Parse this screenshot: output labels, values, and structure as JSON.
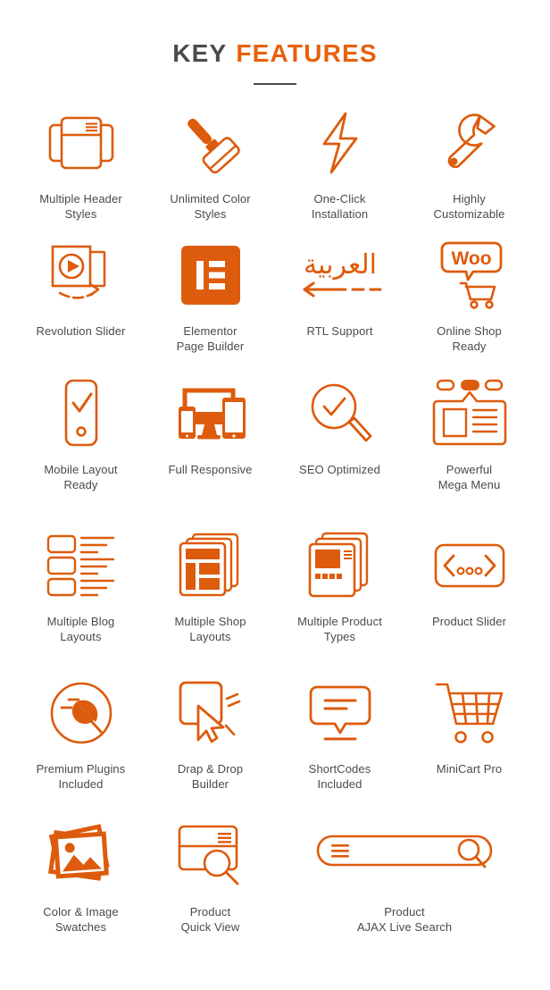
{
  "header": {
    "title_part1": "KEY",
    "title_part2": "FEATURES",
    "accent_color": "#e8600b",
    "text_color": "#4a4a4f"
  },
  "theme": {
    "orange": "#dd5b0c",
    "orange_bright": "#e8600b",
    "label_color": "#4a4a4f",
    "background": "#ffffff"
  },
  "features": [
    {
      "id": "multiple-header-styles",
      "label": "Multiple Header\nStyles",
      "icon": "header-layout-icon"
    },
    {
      "id": "unlimited-color-styles",
      "label": "Unlimited Color\nStyles",
      "icon": "paint-roller-icon"
    },
    {
      "id": "one-click-installation",
      "label": "One-Click\nInstallation",
      "icon": "lightning-bolt-icon"
    },
    {
      "id": "highly-customizable",
      "label": "Highly\nCustomizable",
      "icon": "wrench-icon"
    },
    {
      "id": "revolution-slider",
      "label": "Revolution Slider",
      "icon": "slider-play-icon"
    },
    {
      "id": "elementor-page-builder",
      "label": "Elementor\nPage Builder",
      "icon": "elementor-logo-icon"
    },
    {
      "id": "rtl-support",
      "label": "RTL Support",
      "icon": "arabic-rtl-arrow-icon",
      "icon_text": "العربية"
    },
    {
      "id": "online-shop-ready",
      "label": "Online Shop\nReady",
      "icon": "woocommerce-cart-icon",
      "icon_text": "Woo"
    },
    {
      "id": "mobile-layout-ready",
      "label": "Mobile Layout\nReady",
      "icon": "mobile-check-icon"
    },
    {
      "id": "full-responsive",
      "label": "Full Responsive",
      "icon": "responsive-devices-icon"
    },
    {
      "id": "seo-optimized",
      "label": "SEO Optimized",
      "icon": "magnifier-check-icon"
    },
    {
      "id": "powerful-mega-menu",
      "label": "Powerful\nMega Menu",
      "icon": "mega-menu-icon"
    },
    {
      "id": "multiple-blog-layouts",
      "label": "Multiple Blog\nLayouts",
      "icon": "blog-list-icon"
    },
    {
      "id": "multiple-shop-layouts",
      "label": "Multiple Shop\nLayouts",
      "icon": "shop-pages-icon"
    },
    {
      "id": "multiple-product-types",
      "label": "Multiple Product\nTypes",
      "icon": "product-cards-icon"
    },
    {
      "id": "product-slider",
      "label": "Product Slider",
      "icon": "carousel-arrows-icon"
    },
    {
      "id": "premium-plugins-included",
      "label": "Premium Plugins\nIncluded",
      "icon": "plug-circle-icon"
    },
    {
      "id": "drap-drop-builder",
      "label": "Drap & Drop\nBuilder",
      "icon": "drag-drop-cursor-icon"
    },
    {
      "id": "shortcodes-included",
      "label": "ShortCodes\nIncluded",
      "icon": "speech-bubble-lines-icon"
    },
    {
      "id": "minicart-pro",
      "label": "MiniCart Pro",
      "icon": "shopping-cart-icon"
    },
    {
      "id": "color-image-swatches",
      "label": "Color & Image\nSwatches",
      "icon": "photo-stack-icon"
    },
    {
      "id": "product-quick-view",
      "label": "Product\nQuick View",
      "icon": "quick-view-card-icon"
    },
    {
      "id": "product-ajax-live-search",
      "label": "Product\nAJAX Live Search",
      "icon": "search-bar-icon"
    }
  ]
}
